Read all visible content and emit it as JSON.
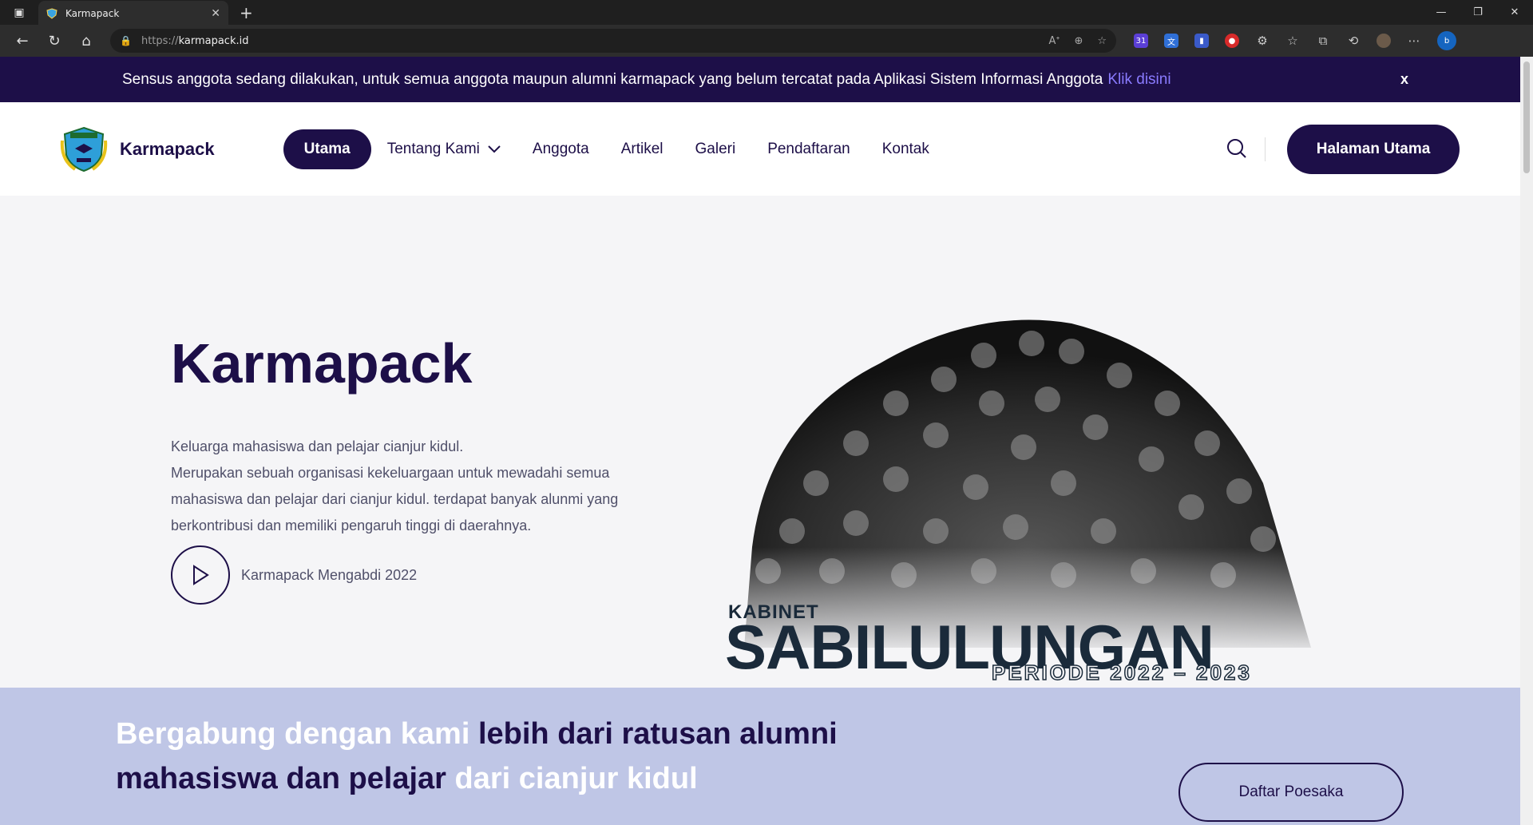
{
  "browser": {
    "tab_title": "Karmapack",
    "url_protocol": "https://",
    "url_host": "karmapack.id",
    "badge_count": "31"
  },
  "banner": {
    "message": "Sensus anggota sedang dilakukan, untuk semua anggota maupun alumni karmapack yang belum tercatat pada Aplikasi Sistem Informasi Anggota",
    "link_text": "Klik disini",
    "close_label": "x"
  },
  "header": {
    "brand": "Karmapack",
    "menu": [
      "Utama",
      "Tentang Kami",
      "Anggota",
      "Artikel",
      "Galeri",
      "Pendaftaran",
      "Kontak"
    ],
    "cta_label": "Halaman Utama"
  },
  "hero": {
    "title": "Karmapack",
    "tagline": "Keluarga mahasiswa dan pelajar cianjur kidul.",
    "description": "Merupakan sebuah organisasi kekeluargaan untuk mewadahi semua mahasiswa dan pelajar dari cianjur kidul. terdapat banyak alunmi yang berkontribusi dan memiliki pengaruh tinggi di daerahnya.",
    "video_label": "Karmapack Mengabdi 2022",
    "cabinet_small": "KABINET",
    "cabinet_name": "SABILULUNGAN",
    "cabinet_period": "PERIODE 2022 – 2023"
  },
  "join": {
    "part1": "Bergabung dengan kami",
    "part2": "lebih dari ratusan alumni mahasiswa dan pelajar",
    "part3": "dari cianjur kidul",
    "button_label": "Daftar Poesaka"
  },
  "colors": {
    "brand_dark": "#1d0f48",
    "link": "#8a7bff",
    "join_bg": "#bfc6e6"
  }
}
